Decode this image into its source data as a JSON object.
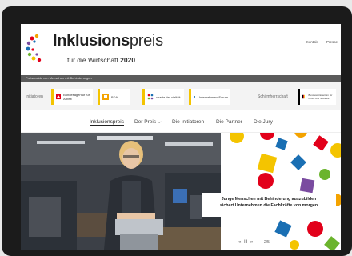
{
  "header": {
    "title_main": "Inklusions",
    "title_rest": "preis",
    "subtitle": "für die Wirtschaft",
    "year": "2020",
    "links": [
      "Kontakt",
      "Presse"
    ]
  },
  "topbar": {
    "text": "Preisnoside von Menschen mit Behinderungen"
  },
  "partners": {
    "initiators_label": "Initiatoren",
    "patron_label": "Schirmherrschaft",
    "logos": [
      {
        "text": "Bundesagentur für Arbeit",
        "color": "#e2001a"
      },
      {
        "text": "BDA",
        "color": "#f4a300"
      },
      {
        "text": "charta der vielfalt",
        "color": "#7a4ba0"
      },
      {
        "text": "UnternehmensForum",
        "color": "#1a6fb3"
      },
      {
        "text": "Bundesministerium für Arbeit und Soziales",
        "color": "#000000"
      }
    ]
  },
  "nav": {
    "items": [
      "Inklusionspreis",
      "Der Preis",
      "Die Initiatoren",
      "Die Partner",
      "Die Jury"
    ]
  },
  "hero": {
    "caption_line1": "Junge Menschen mit Behinderung auszubilden",
    "caption_line2": "sichert Unternehmen die Fachkräfte von morgen",
    "controls": "«  II  »",
    "counter": "2/5"
  }
}
